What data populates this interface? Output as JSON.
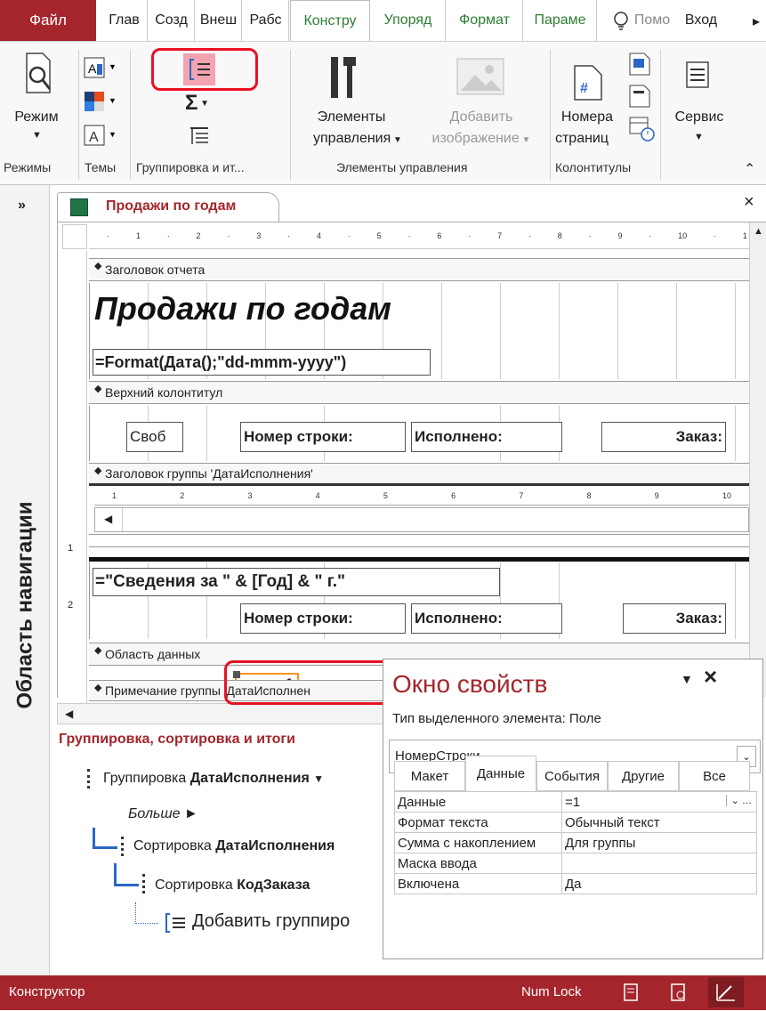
{
  "ribbon_tabs": [
    "Файл",
    "Глав",
    "Созд",
    "Внеш",
    "Рабс",
    "Констру",
    "Упоряд",
    "Формат",
    "Параме"
  ],
  "help_tab": "Помо",
  "signin": "Вход",
  "ribbon": {
    "mode_label_1": "Режим",
    "controls_label_1": "Элементы",
    "controls_label_2": "управления",
    "image_label_1": "Добавить",
    "image_label_2": "изображение",
    "pagenum_label_1": "Номера",
    "pagenum_label_2": "страниц",
    "service_label": "Сервис",
    "group_modes": "Режимы",
    "group_themes": "Темы",
    "group_grouping": "Группировка и ит...",
    "group_controls": "Элементы управления",
    "group_headers": "Колонтитулы"
  },
  "nav": {
    "expand": "»",
    "title": "Область навигации"
  },
  "document": {
    "tab_title": "Продажи по годам",
    "close": "×",
    "ruler_numbers": [
      "1",
      "2",
      "3",
      "4",
      "5",
      "6",
      "7",
      "8",
      "9",
      "10",
      "1"
    ],
    "sub_ruler_numbers": [
      "1",
      "2",
      "3",
      "4",
      "5",
      "6",
      "7",
      "8",
      "9",
      "10"
    ],
    "sections": {
      "report_header": "Заголовок отчета",
      "page_header": "Верхний колонтитул",
      "group_header": "Заголовок группы 'ДатаИсполнения'",
      "detail": "Область данных",
      "group_footer": "Примечание группы 'ДатаИсполнен"
    },
    "report_title": "Продажи по годам",
    "date_expr": "=Format(Дата();\"dd-mmm-yyyy\")",
    "page_header_fields": [
      "Своб",
      "Номер строки:",
      "Исполнено:",
      "Заказ:"
    ],
    "group_expr": "=\"Сведения за \" & [Год] & \" г.\"",
    "group_fields": [
      "Номер строки:",
      "Исполнено:",
      "Заказ:"
    ],
    "detail_field": "=1",
    "left_margin_marks": [
      "1",
      "2"
    ]
  },
  "grouping": {
    "title": "Группировка, сортировка и итоги",
    "row1_prefix": "Группировка ",
    "row1_field": "ДатаИсполнения",
    "more": "Больше ►",
    "row2_prefix": "Сортировка ",
    "row2_field": "ДатаИсполнения",
    "row3_prefix": "Сортировка ",
    "row3_field": "КодЗаказа",
    "add_group": "Добавить группиро"
  },
  "property_sheet": {
    "title": "Окно свойств",
    "selection_type": "Тип выделенного элемента:  Поле",
    "selected_object": "НомерСтроки",
    "tabs": [
      "Макет",
      "Данные",
      "События",
      "Другие",
      "Все"
    ],
    "active_tab": "Данные",
    "rows": [
      {
        "name": "Данные",
        "value": "=1"
      },
      {
        "name": "Формат текста",
        "value": "Обычный текст"
      },
      {
        "name": "Сумма с накоплением",
        "value": "Для группы"
      },
      {
        "name": "Маска ввода",
        "value": ""
      },
      {
        "name": "Включена",
        "value": "Да"
      }
    ]
  },
  "status": {
    "mode": "Конструктор",
    "numlock": "Num Lock"
  },
  "colors": {
    "accent": "#a4262c",
    "highlight": "#e81123",
    "selection": "#f7941d"
  }
}
